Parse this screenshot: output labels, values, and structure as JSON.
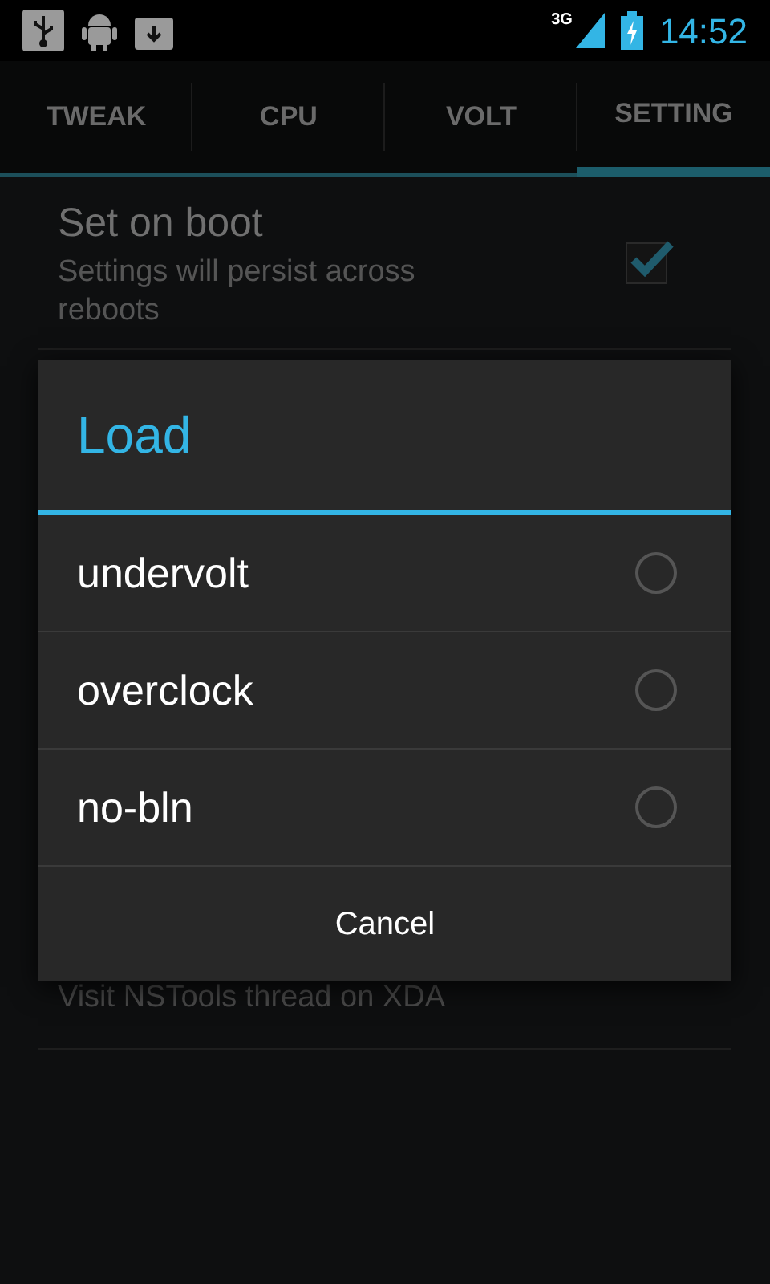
{
  "status_bar": {
    "network": "3G",
    "time": "14:52"
  },
  "tabs": [
    {
      "label": "TWEAK",
      "selected": false
    },
    {
      "label": "CPU",
      "selected": false
    },
    {
      "label": "VOLT",
      "selected": false
    },
    {
      "label": "SETTING",
      "selected": true
    }
  ],
  "settings": [
    {
      "title": "Set on boot",
      "summary": "Settings will persist across reboots",
      "checked": true
    }
  ],
  "visit_item": {
    "summary": "Visit NSTools thread on XDA"
  },
  "dialog": {
    "title": "Load",
    "options": [
      {
        "label": "undervolt",
        "selected": false
      },
      {
        "label": "overclock",
        "selected": false
      },
      {
        "label": "no-bln",
        "selected": false
      }
    ],
    "cancel": "Cancel"
  }
}
